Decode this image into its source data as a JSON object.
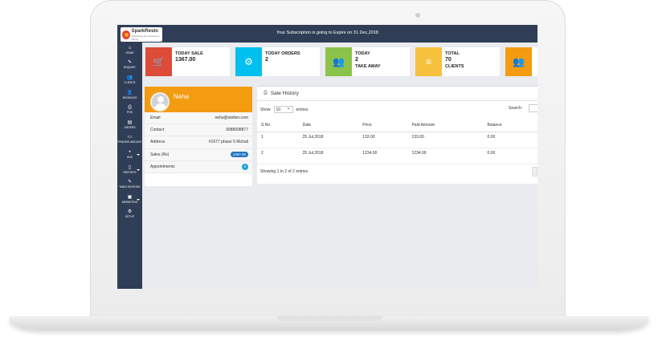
{
  "header": {
    "logo_name": "SparkResto",
    "logo_tagline": "Redefining the Concept of Dining",
    "subscription_message": "Your Subscription is going to Expire on 31 Dec,2018"
  },
  "sidebar": {
    "items": [
      {
        "label": "HOME",
        "icon": "home-icon",
        "glyph": "⌂"
      },
      {
        "label": "ENQUIRY",
        "icon": "pencil-icon",
        "glyph": "✎"
      },
      {
        "label": "CLIENTS",
        "icon": "users-icon",
        "glyph": "👥"
      },
      {
        "label": "BOOKINGS",
        "icon": "user-icon",
        "glyph": "👤"
      },
      {
        "label": "POS",
        "icon": "printer-icon",
        "glyph": "⎙"
      },
      {
        "label": "ORDERS",
        "icon": "id-card-icon",
        "glyph": "▤"
      },
      {
        "label": "PENDING AMOUNT",
        "icon": "credit-card-icon",
        "glyph": "▭"
      },
      {
        "label": "ADD",
        "icon": "plus-icon",
        "glyph": "+"
      },
      {
        "label": "REPORTS",
        "icon": "file-icon",
        "glyph": "▯"
      },
      {
        "label": "TABLE BOOKING",
        "icon": "edit-icon",
        "glyph": "✎"
      },
      {
        "label": "MARKETING",
        "icon": "briefcase-icon",
        "glyph": "▣"
      },
      {
        "label": "SETUP",
        "icon": "gear-icon",
        "glyph": "⚙"
      }
    ]
  },
  "stats": [
    {
      "label1": "TODAY SALE",
      "value": "1367.00",
      "label2": "",
      "color": "#dd4b39",
      "icon": "cart-icon",
      "glyph": "🛒"
    },
    {
      "label1": "TODAY ORDERS",
      "value": "2",
      "label2": "",
      "color": "#00c0ef",
      "icon": "gear-icon",
      "glyph": "⚙"
    },
    {
      "label1": "TODAY",
      "value": "2",
      "label2": "TAKE AWAY",
      "color": "#8bc34a",
      "icon": "people-icon",
      "glyph": "👥"
    },
    {
      "label1": "TOTAL",
      "value": "70",
      "label2": "CLIENTS",
      "color": "#f6c23e",
      "icon": "database-icon",
      "glyph": "≡"
    },
    {
      "label1": "",
      "value": "",
      "label2": "",
      "color": "#f39c12",
      "icon": "people-icon",
      "glyph": "👥"
    }
  ],
  "profile": {
    "name": "Neha",
    "rows": [
      {
        "label": "Email",
        "value": "neha@stellen.com"
      },
      {
        "label": "Contact",
        "value": "9988998877"
      },
      {
        "label": "Address",
        "value": "#1677 phase 5 Mohali"
      },
      {
        "label": "Sales (Rs)",
        "value": "1367.00"
      },
      {
        "label": "Appointments",
        "value": "2"
      }
    ]
  },
  "sale_history": {
    "title": "Sale History",
    "show_label": "Show",
    "entries_value": "10",
    "entries_label": "entries",
    "search_label": "Search:",
    "columns": [
      "S.No",
      "Date",
      "Price",
      "Paid Amount",
      "Balance"
    ],
    "rows": [
      [
        "1",
        "25 Jul,2018",
        "133.00",
        "133.00",
        "0.00"
      ],
      [
        "2",
        "25 Jul,2018",
        "1234.00",
        "1234.00",
        "0.00"
      ]
    ],
    "footer": "Showing 1 to 2 of 2 entries"
  }
}
